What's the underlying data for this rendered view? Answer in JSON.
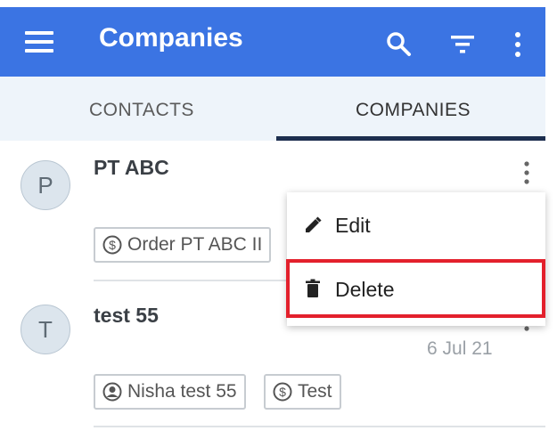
{
  "appbar": {
    "title": "Companies",
    "icons": [
      "menu-icon",
      "search-icon",
      "filter-icon",
      "more-vert-icon"
    ],
    "color": "#3b74e3"
  },
  "tabs": [
    {
      "label": "CONTACTS",
      "active": false
    },
    {
      "label": "COMPANIES",
      "active": true
    }
  ],
  "companies": [
    {
      "initial": "P",
      "name": "PT ABC",
      "chips": [
        {
          "icon": "dollar-icon",
          "label": "Order PT ABC II"
        }
      ]
    },
    {
      "initial": "T",
      "name": "test 55",
      "date": "6 Jul 21",
      "chips": [
        {
          "icon": "contact-icon",
          "label": "Nisha test 55"
        },
        {
          "icon": "dollar-icon",
          "label": "Test"
        }
      ]
    }
  ],
  "context_menu": {
    "items": [
      {
        "icon": "edit-icon",
        "label": "Edit"
      },
      {
        "icon": "trash-icon",
        "label": "Delete",
        "highlighted": true
      }
    ],
    "highlight_color": "#e3202c"
  }
}
